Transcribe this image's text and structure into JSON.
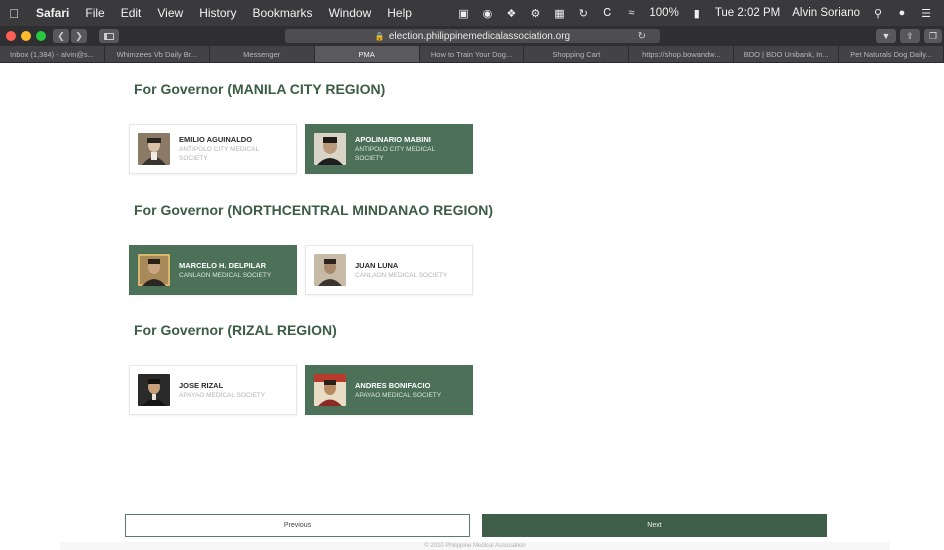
{
  "menubar": {
    "app_name": "Safari",
    "menus": [
      "File",
      "Edit",
      "View",
      "History",
      "Bookmarks",
      "Window",
      "Help"
    ],
    "battery": "100%",
    "clock": "Tue 2:02 PM",
    "user": "Alvin Soriano"
  },
  "browser": {
    "url": "election.philippinemedicalassociation.org",
    "tabs": [
      {
        "label": "Inbox (1,384) - alvin@s..."
      },
      {
        "label": "Whimzees Vb Daily Br..."
      },
      {
        "label": "Messenger"
      },
      {
        "label": "PMA"
      },
      {
        "label": "How to Train Your Dog..."
      },
      {
        "label": "Shopping Cart"
      },
      {
        "label": "https://shop.bowandw..."
      },
      {
        "label": "BDO | BDO Unibank, In..."
      },
      {
        "label": "Pet Naturals Dog Daily..."
      }
    ],
    "active_tab": "PMA"
  },
  "sections": [
    {
      "title": "For Governor (MANILA CITY REGION)",
      "candidates": [
        {
          "name": "EMILIO AGUINALDO",
          "society": "ANTIPOLO CITY MEDICAL SOCIETY",
          "selected": false
        },
        {
          "name": "APOLINARIO MABINI",
          "society": "ANTIPOLO CITY MEDICAL SOCIETY",
          "selected": true
        }
      ]
    },
    {
      "title": "For Governor (NORTHCENTRAL MINDANAO REGION)",
      "candidates": [
        {
          "name": "MARCELO H. DELPILAR",
          "society": "CANLAON MEDICAL SOCIETY",
          "selected": true
        },
        {
          "name": "JUAN LUNA",
          "society": "CANLAON MEDICAL SOCIETY",
          "selected": false
        }
      ]
    },
    {
      "title": "For Governor (RIZAL REGION)",
      "candidates": [
        {
          "name": "JOSE RIZAL",
          "society": "APAYAO MEDICAL SOCIETY",
          "selected": false
        },
        {
          "name": "ANDRES BONIFACIO",
          "society": "APAYAO MEDICAL SOCIETY",
          "selected": true
        }
      ]
    }
  ],
  "nav": {
    "previous_label": "Previous",
    "next_label": "Next"
  },
  "footer": {
    "text": "© 2020 Philippine Medical Association"
  },
  "colors": {
    "accent": "#4d7158",
    "title": "#3b5c45",
    "next_button": "#3f5e47"
  }
}
